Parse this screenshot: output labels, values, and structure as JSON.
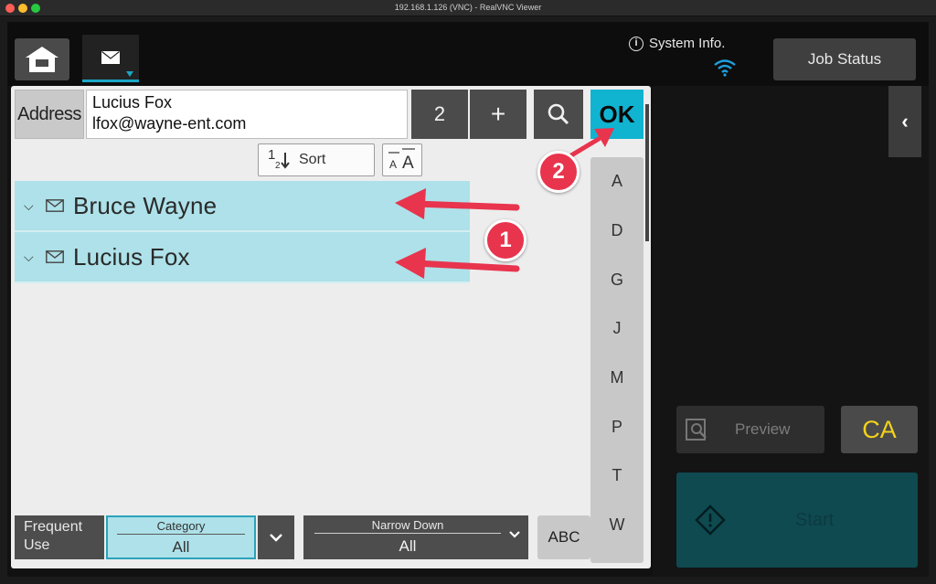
{
  "window": {
    "title": "192.168.1.126 (VNC) - RealVNC Viewer"
  },
  "topbar": {
    "system_info_label": "System Info.",
    "job_status_label": "Job Status"
  },
  "address": {
    "label": "Address",
    "name": "Lucius Fox",
    "email": "lfox@wayne-ent.com",
    "count": "2",
    "add_label": "+",
    "ok_label": "OK"
  },
  "toolbar": {
    "sort_number_top": "1",
    "sort_number_bottom": "2",
    "sort_label": "Sort"
  },
  "contacts": [
    {
      "name": "Bruce Wayne",
      "type": "mail-icon"
    },
    {
      "name": "Lucius Fox",
      "type": "mail-icon"
    }
  ],
  "alphabet_index": [
    "A",
    "D",
    "G",
    "J",
    "M",
    "P",
    "T",
    "W"
  ],
  "bottom": {
    "frequent_use_label": "Frequent Use",
    "category_label": "Category",
    "category_value": "All",
    "narrow_down_label": "Narrow Down",
    "narrow_down_value": "All",
    "abc_label": "ABC"
  },
  "right_panel": {
    "preview_label": "Preview",
    "ca_label": "CA",
    "start_label": "Start"
  },
  "annotations": {
    "step1": "1",
    "step2": "2"
  },
  "colors": {
    "accent": "#10b4d0",
    "selected_row": "#aee1e9",
    "annotation": "#e8344d",
    "ca_text": "#f2d21a"
  }
}
